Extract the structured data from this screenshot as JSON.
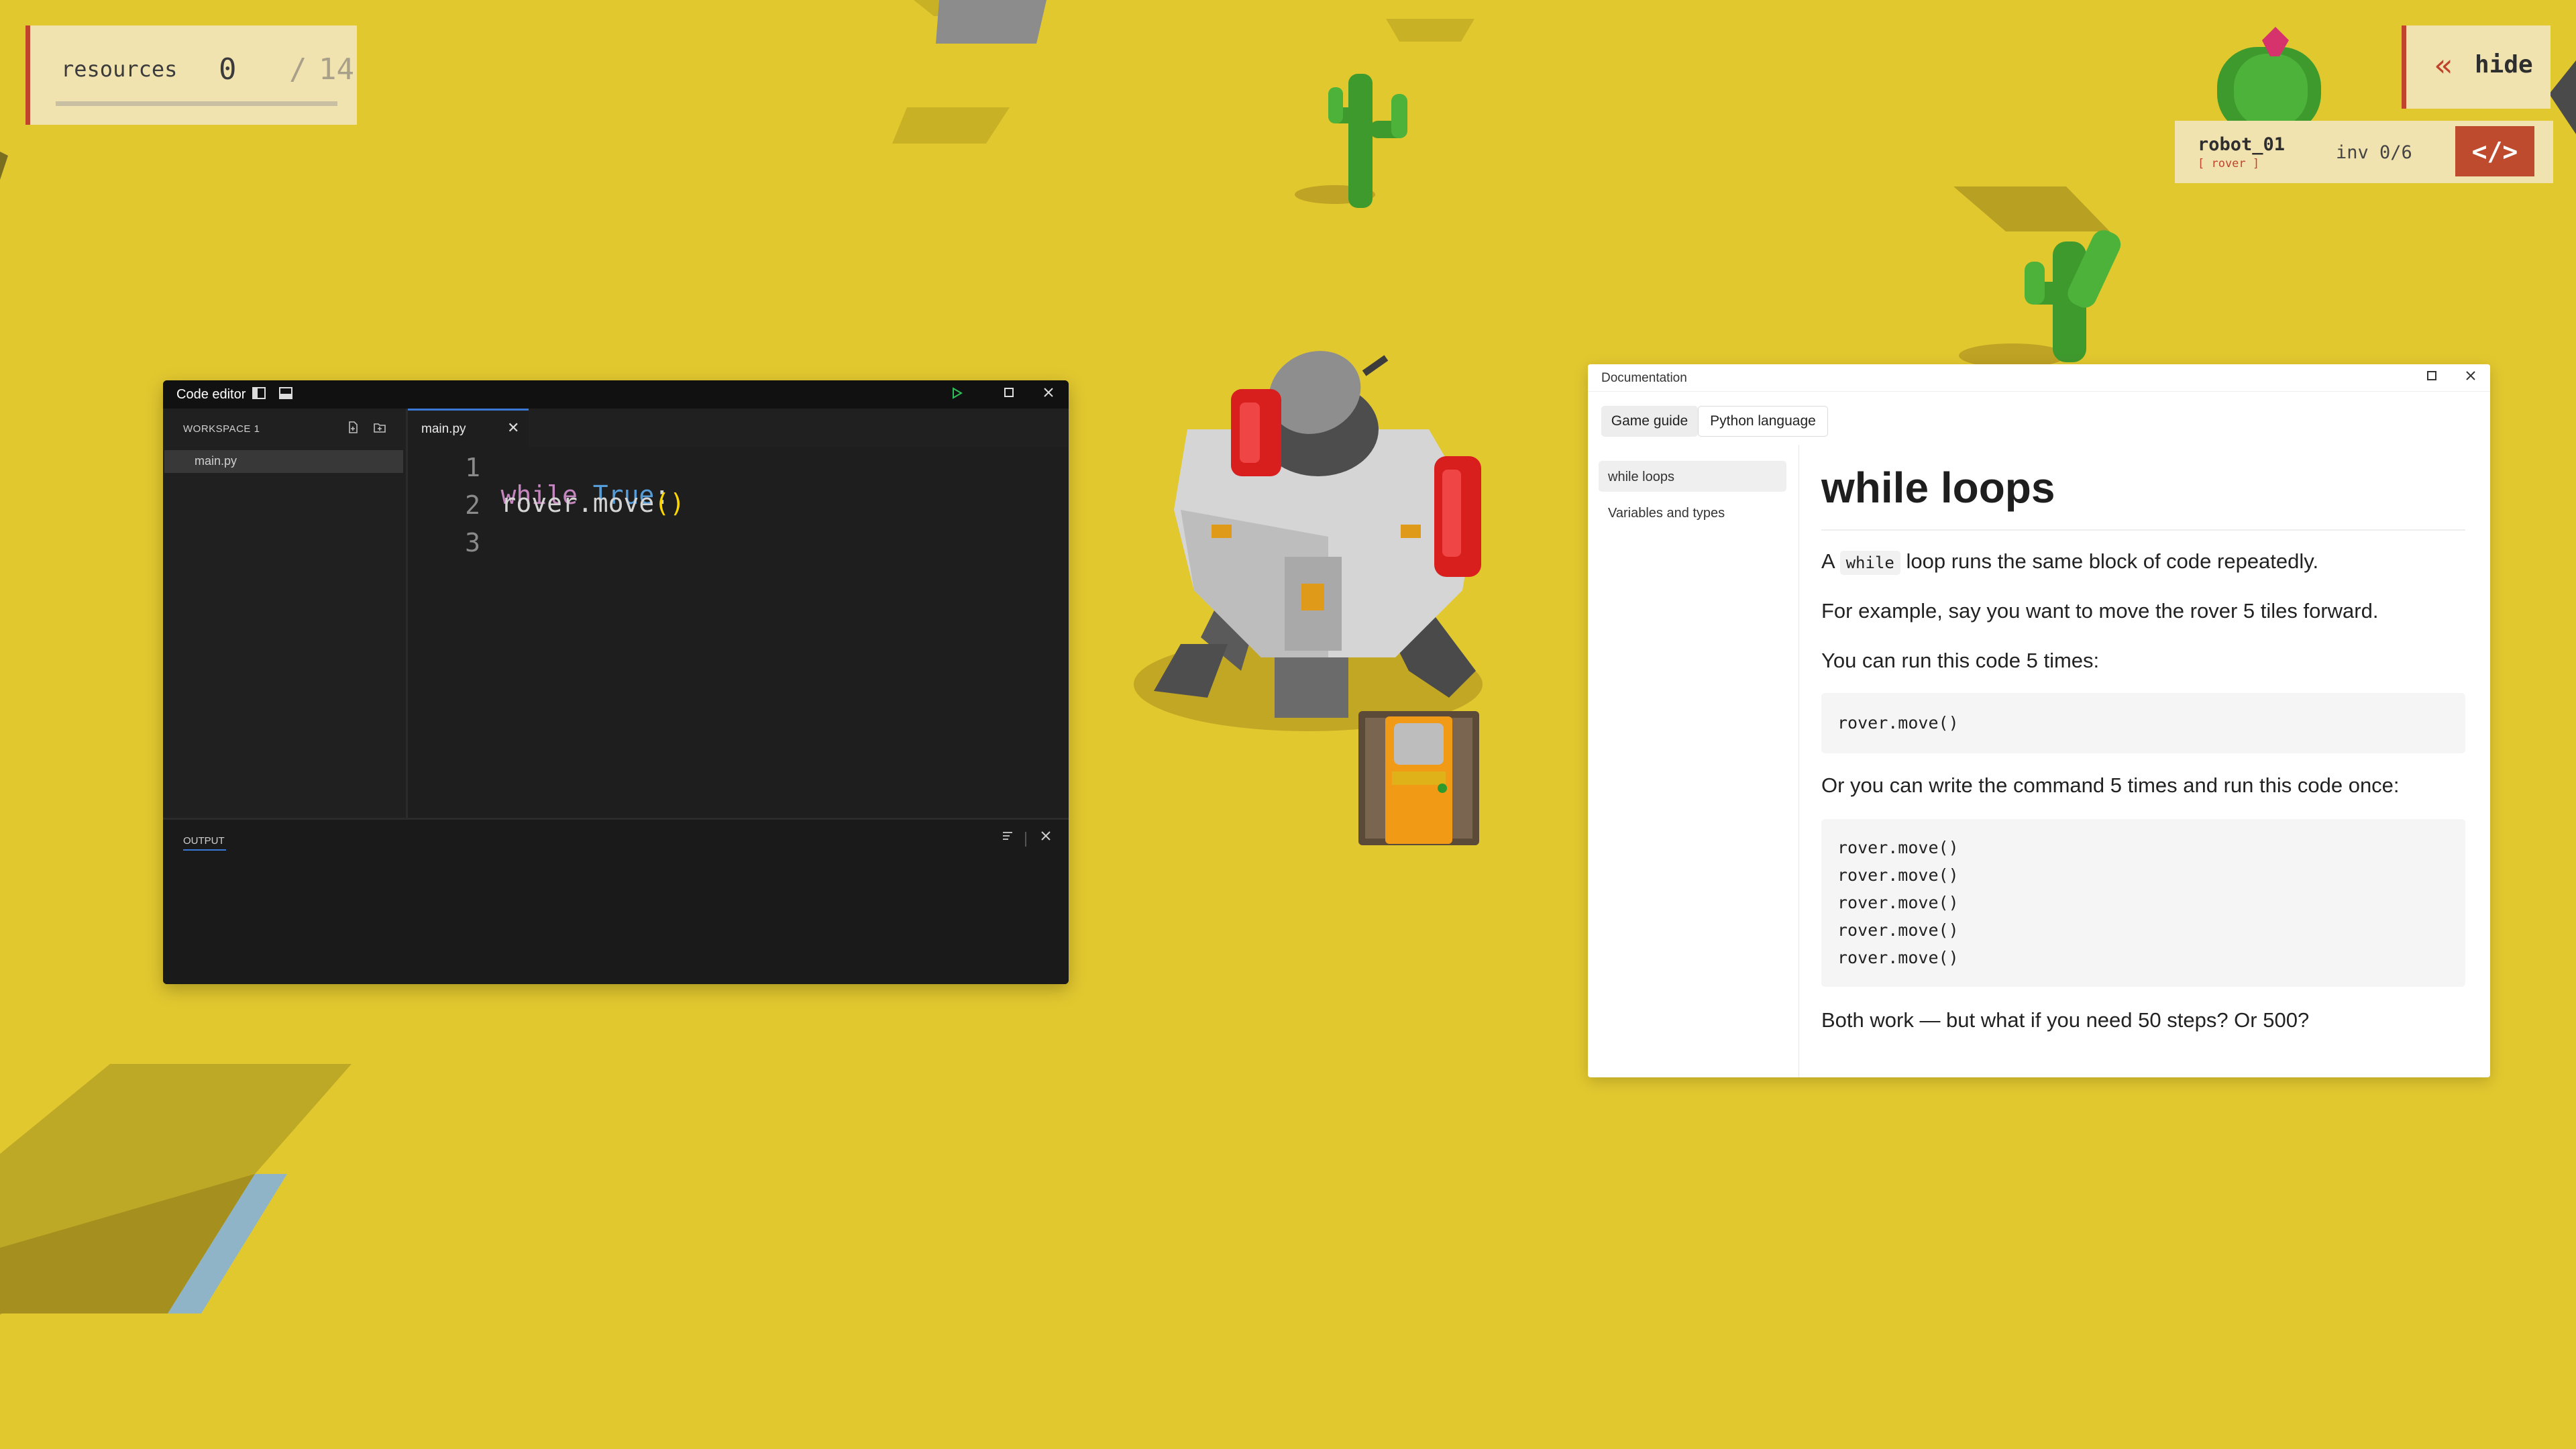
{
  "hud": {
    "resources_label": "resources",
    "resources_collected": "0",
    "resources_separator": "/",
    "resources_total": "14",
    "resources_progress": 0,
    "hide_chevron": "«",
    "hide_label": "hide",
    "robot_name": "robot_01",
    "robot_type": "[ rover ]",
    "robot_inventory": "inv 0/6",
    "code_button": "</>"
  },
  "editor": {
    "title": "Code editor",
    "sidebar_toggle_icon": "sidebar-left-icon",
    "panel_toggle_icon": "panel-bottom-icon",
    "run_icon": "play-icon",
    "maximize_icon": "maximize-icon",
    "close_icon": "close-icon",
    "workspace_label": "WORKSPACE 1",
    "new_file_icon": "new-file-icon",
    "new_folder_icon": "new-folder-icon",
    "files": [
      "main.py"
    ],
    "active_tab": "main.py",
    "line_numbers": [
      "1",
      "2",
      "3"
    ],
    "code": {
      "line1_keyword": "while",
      "line1_value": "True",
      "line1_colon": ":",
      "line2_indent": "    ",
      "line2_call": "rover.move",
      "line2_parens": "()"
    },
    "output_label": "OUTPUT",
    "clear_output_icon": "clear-output-icon",
    "close_output_icon": "close-icon",
    "colors": {
      "keyword": "#C586C0",
      "boolean": "#569CD6",
      "paren": "#FFD700",
      "text": "#D4D4D4",
      "accent": "#3A78D6"
    }
  },
  "docs": {
    "title": "Documentation",
    "tabs": [
      "Game guide",
      "Python language"
    ],
    "active_tab": "Python language",
    "nav": [
      "while loops",
      "Variables and types"
    ],
    "active_nav": "while loops",
    "heading": "while loops",
    "p1_before": "A",
    "p1_code": "while",
    "p1_after": "loop runs the same block of code repeatedly.",
    "p2": "For example, say you want to move the rover 5 tiles forward.",
    "p3": "You can run this code 5 times:",
    "code1": [
      "rover.move()"
    ],
    "p4": "Or you can write the command 5 times and run this code once:",
    "code2": [
      "rover.move()",
      "rover.move()",
      "rover.move()",
      "rover.move()",
      "rover.move()"
    ],
    "p5": "Both work — but what if you need 50 steps? Or 500?"
  },
  "colors": {
    "ground": "#E2C82F",
    "hud_panel": "#F1E3B0",
    "hud_accent": "#C0442B"
  }
}
